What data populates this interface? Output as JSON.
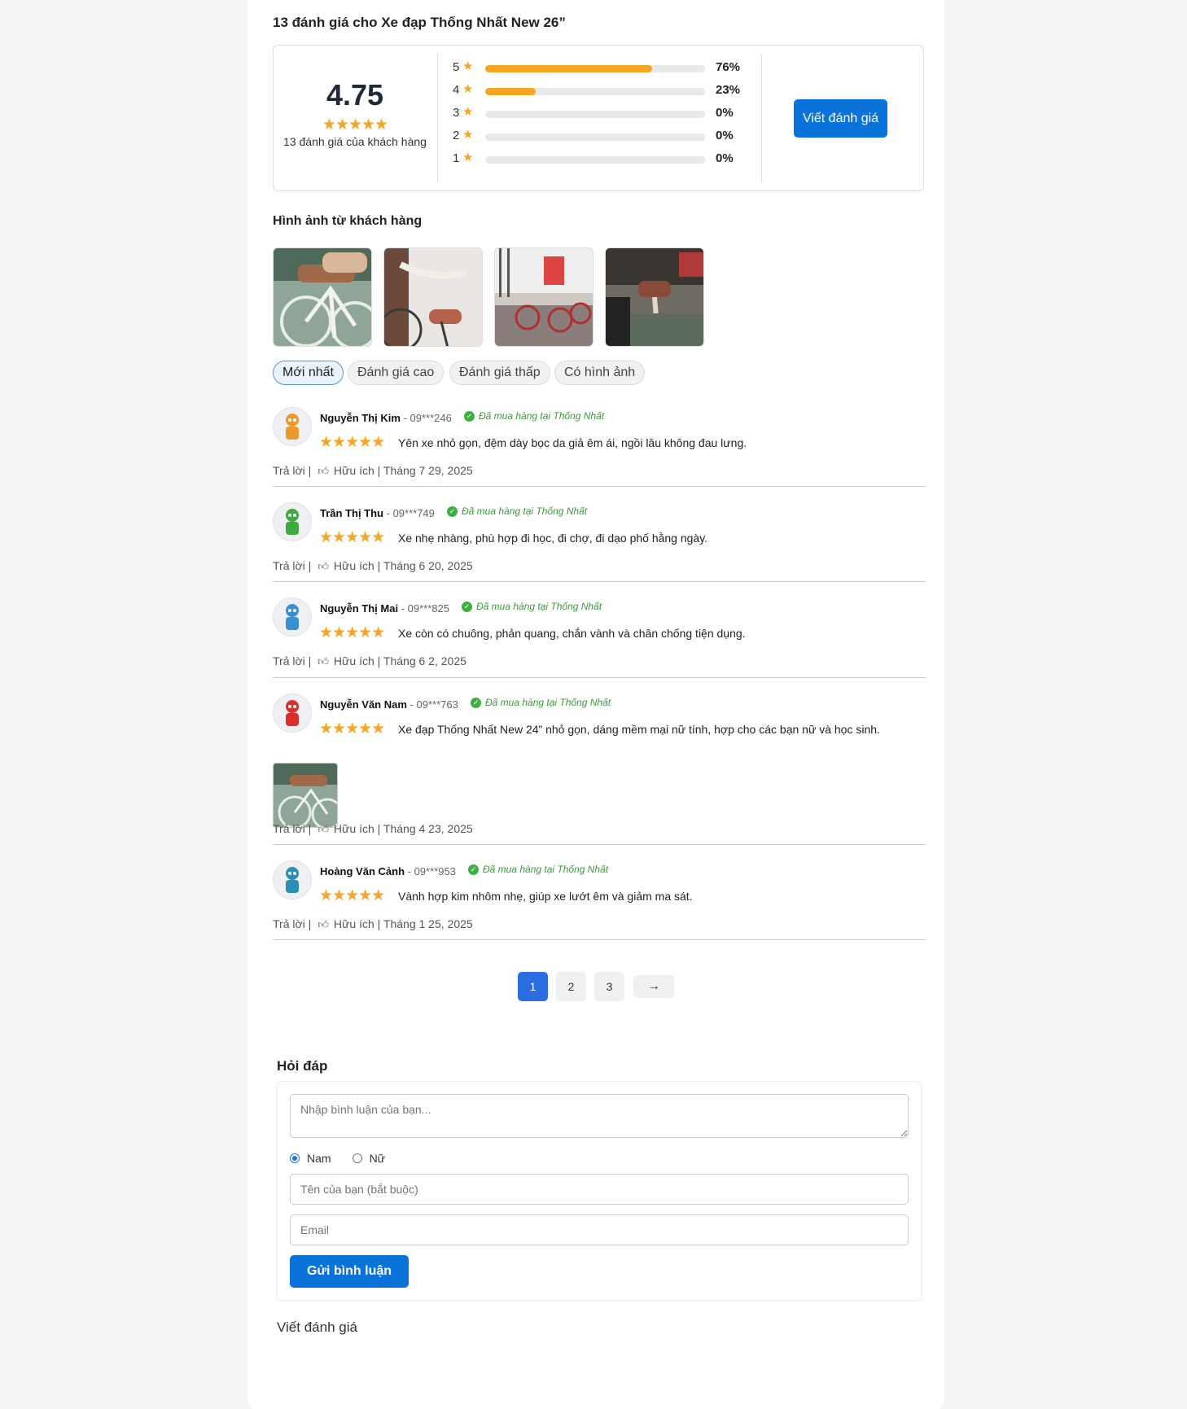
{
  "title": "13 đánh giá cho Xe đạp Thống Nhất New 26”",
  "summary": {
    "average": "4.75",
    "average_stars": "★★★★★",
    "count_text": "13 đánh giá của khách hàng",
    "bars": [
      {
        "star": "5",
        "percent_label": "76%",
        "fraction": 0.76
      },
      {
        "star": "4",
        "percent_label": "23%",
        "fraction": 0.23
      },
      {
        "star": "3",
        "percent_label": "0%",
        "fraction": 0
      },
      {
        "star": "2",
        "percent_label": "0%",
        "fraction": 0
      },
      {
        "star": "1",
        "percent_label": "0%",
        "fraction": 0
      }
    ],
    "write_button": "Viết đánh giá"
  },
  "photos": {
    "heading": "Hình ảnh từ khách hàng",
    "count": 4
  },
  "filters": [
    "Mới nhất",
    "Đánh giá cao",
    "Đánh giá thấp",
    "Có hình ảnh"
  ],
  "verified_label": "Đã mua hàng tại Thống Nhất",
  "reply_label": "Trả lời",
  "helpful_label": "Hữu ích",
  "reviews": [
    {
      "name": "Nguyễn Thị Kim",
      "phone": "09***246",
      "stars": "★★★★★",
      "text": "Yên xe nhỏ gọn, đệm dày bọc da giả êm ái, ngồi lâu không đau lưng.",
      "date": "Tháng 7 29, 2025",
      "avatar_color": "#e89a2c"
    },
    {
      "name": "Trần Thị Thu",
      "phone": "09***749",
      "stars": "★★★★★",
      "text": "Xe nhẹ nhàng, phù hợp đi học, đi chợ, đi dạo phố hằng ngày.",
      "date": "Tháng 6 20, 2025",
      "avatar_color": "#3fa83f"
    },
    {
      "name": "Nguyễn Thị Mai",
      "phone": "09***825",
      "stars": "★★★★★",
      "text": "Xe còn có chuông, phản quang, chắn vành và chân chống tiện dụng.",
      "date": "Tháng 6 2, 2025",
      "avatar_color": "#3a8fd0"
    },
    {
      "name": "Nguyễn Văn Nam",
      "phone": "09***763",
      "stars": "★★★★★",
      "text": "Xe đạp Thống Nhất New 24” nhỏ gọn, dáng mềm mại nữ tính, hợp cho các bạn nữ và học sinh.",
      "date": "Tháng 4 23, 2025",
      "avatar_color": "#d8312c"
    },
    {
      "name": "Hoàng Văn Cảnh",
      "phone": "09***953",
      "stars": "★★★★★",
      "text": "Vành hợp kim nhôm nhẹ, giúp xe lướt êm và giảm ma sát.",
      "date": "Tháng 1 25, 2025",
      "avatar_color": "#2b8fb5"
    }
  ],
  "pagination": {
    "pages": [
      "1",
      "2",
      "3"
    ],
    "next": "→",
    "current": "1"
  },
  "qa": {
    "heading": "Hỏi đáp",
    "comment_placeholder": "Nhập bình luận của bạn...",
    "gender_male": "Nam",
    "gender_female": "Nữ",
    "name_placeholder": "Tên của bạn (bắt buộc)",
    "email_placeholder": "Email",
    "submit": "Gửi bình luận"
  },
  "bottom_link": "Viết đánh giá",
  "colors": {
    "accent": "#0a73d9",
    "star": "#f5a623",
    "verified": "#3d9a3d",
    "page_active": "#2a6de0"
  }
}
